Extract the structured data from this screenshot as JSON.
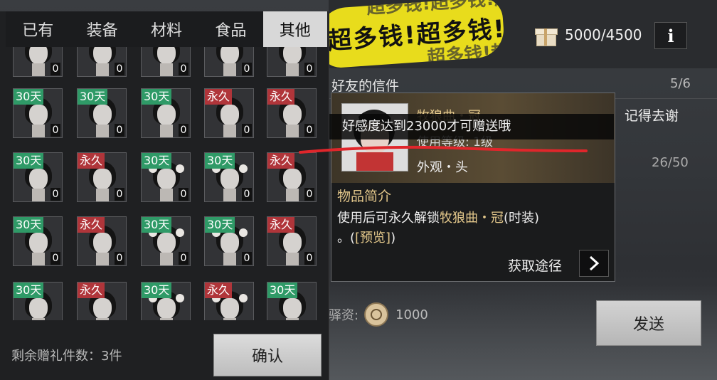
{
  "tabs": [
    {
      "label": "已有"
    },
    {
      "label": "装备"
    },
    {
      "label": "材料"
    },
    {
      "label": "食品"
    },
    {
      "label": "其他"
    }
  ],
  "active_tab": 4,
  "sticker_text": "超多钱!超多钱!超",
  "gift": {
    "count": "5000/4500",
    "icon": "gift-box-icon"
  },
  "info_label": "i",
  "letters": {
    "title": "好友的信件",
    "count": "5/6",
    "thanks": "记得去谢",
    "slots": "26/50"
  },
  "fee": {
    "label": "驿资:",
    "value": "1000",
    "icon": "coin-icon"
  },
  "send_label": "发送",
  "remaining_label": "剩余赠礼件数：3件",
  "confirm_label": "确认",
  "grid": {
    "rows": [
      [
        {
          "badge": "",
          "qty": "0"
        },
        {
          "badge": "",
          "qty": "0"
        },
        {
          "badge": "",
          "qty": "0"
        },
        {
          "badge": "",
          "qty": "0"
        },
        {
          "badge": "",
          "qty": "0"
        }
      ],
      [
        {
          "badge": "30天",
          "type": "green",
          "qty": "0"
        },
        {
          "badge": "30天",
          "type": "green",
          "qty": "0"
        },
        {
          "badge": "30天",
          "type": "green",
          "qty": "0"
        },
        {
          "badge": "永久",
          "type": "red",
          "qty": "0"
        },
        {
          "badge": "永久",
          "type": "red",
          "qty": "0"
        }
      ],
      [
        {
          "badge": "30天",
          "type": "green",
          "qty": "0"
        },
        {
          "badge": "永久",
          "type": "red",
          "qty": "0"
        },
        {
          "badge": "30天",
          "type": "green",
          "qty": "0"
        },
        {
          "badge": "30天",
          "type": "green",
          "qty": "0"
        },
        {
          "badge": "永久",
          "type": "red",
          "qty": "0"
        }
      ],
      [
        {
          "badge": "30天",
          "type": "green",
          "qty": "0"
        },
        {
          "badge": "永久",
          "type": "red",
          "qty": "0"
        },
        {
          "badge": "30天",
          "type": "green",
          "qty": "0"
        },
        {
          "badge": "30天",
          "type": "green",
          "qty": "0"
        },
        {
          "badge": "永久",
          "type": "red",
          "qty": "0"
        }
      ],
      [
        {
          "badge": "30天",
          "type": "green",
          "qty": ""
        },
        {
          "badge": "永久",
          "type": "red",
          "qty": ""
        },
        {
          "badge": "30天",
          "type": "green",
          "qty": ""
        },
        {
          "badge": "永久",
          "type": "red",
          "qty": ""
        },
        {
          "badge": "30天",
          "type": "green",
          "qty": ""
        }
      ]
    ]
  },
  "tooltip": {
    "name": "牧狼曲・冠",
    "level": "使用等级: 1级",
    "kind": "外观・头",
    "section_title": "物品简介",
    "desc_prefix": "使用后可永久解锁",
    "desc_item": "牧狼曲・冠",
    "desc_suffix": "(时装)",
    "desc_line2_prefix": "。",
    "desc_preview": "[预览]",
    "desc_line2_suffix": ")",
    "source_label": "获取途径",
    "source_arrow": ">"
  },
  "toast": "好感度达到23000才可赠送哦",
  "colors": {
    "green_badge": "#2f9a67",
    "red_badge": "#b0353a",
    "gold_text": "#e4c88b",
    "annotation_red": "#e0262b",
    "sticker_yellow": "#f3e61c"
  }
}
